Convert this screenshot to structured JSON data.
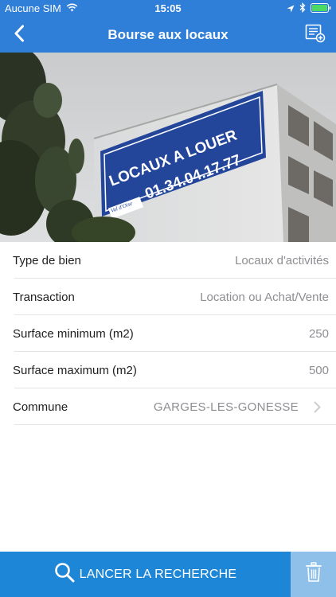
{
  "status_bar": {
    "carrier": "Aucune SIM",
    "time": "15:05"
  },
  "nav": {
    "title": "Bourse aux locaux",
    "back_icon": "chevron-left-icon",
    "action_icon": "list-add-icon"
  },
  "hero": {
    "banner_line1": "LOCAUX A LOUER",
    "banner_line2": "01.34.04.17.77",
    "banner_logo": "Val d'Oise"
  },
  "form": {
    "rows": [
      {
        "label": "Type de bien",
        "value": "Locaux d'activités"
      },
      {
        "label": "Transaction",
        "value": "Location ou Achat/Vente"
      },
      {
        "label": "Surface minimum (m2)",
        "value": "250"
      },
      {
        "label": "Surface maximum (m2)",
        "value": "500"
      },
      {
        "label": "Commune",
        "value": "GARGES-LES-GONESSE"
      }
    ]
  },
  "actions": {
    "search_label": "LANCER LA RECHERCHE",
    "search_icon": "magnifier-icon",
    "trash_icon": "trash-icon"
  },
  "colors": {
    "primary": "#2f7ed8",
    "button": "#1e86d6",
    "button_secondary": "#8ec0ea",
    "value_text": "#8e8e93"
  }
}
